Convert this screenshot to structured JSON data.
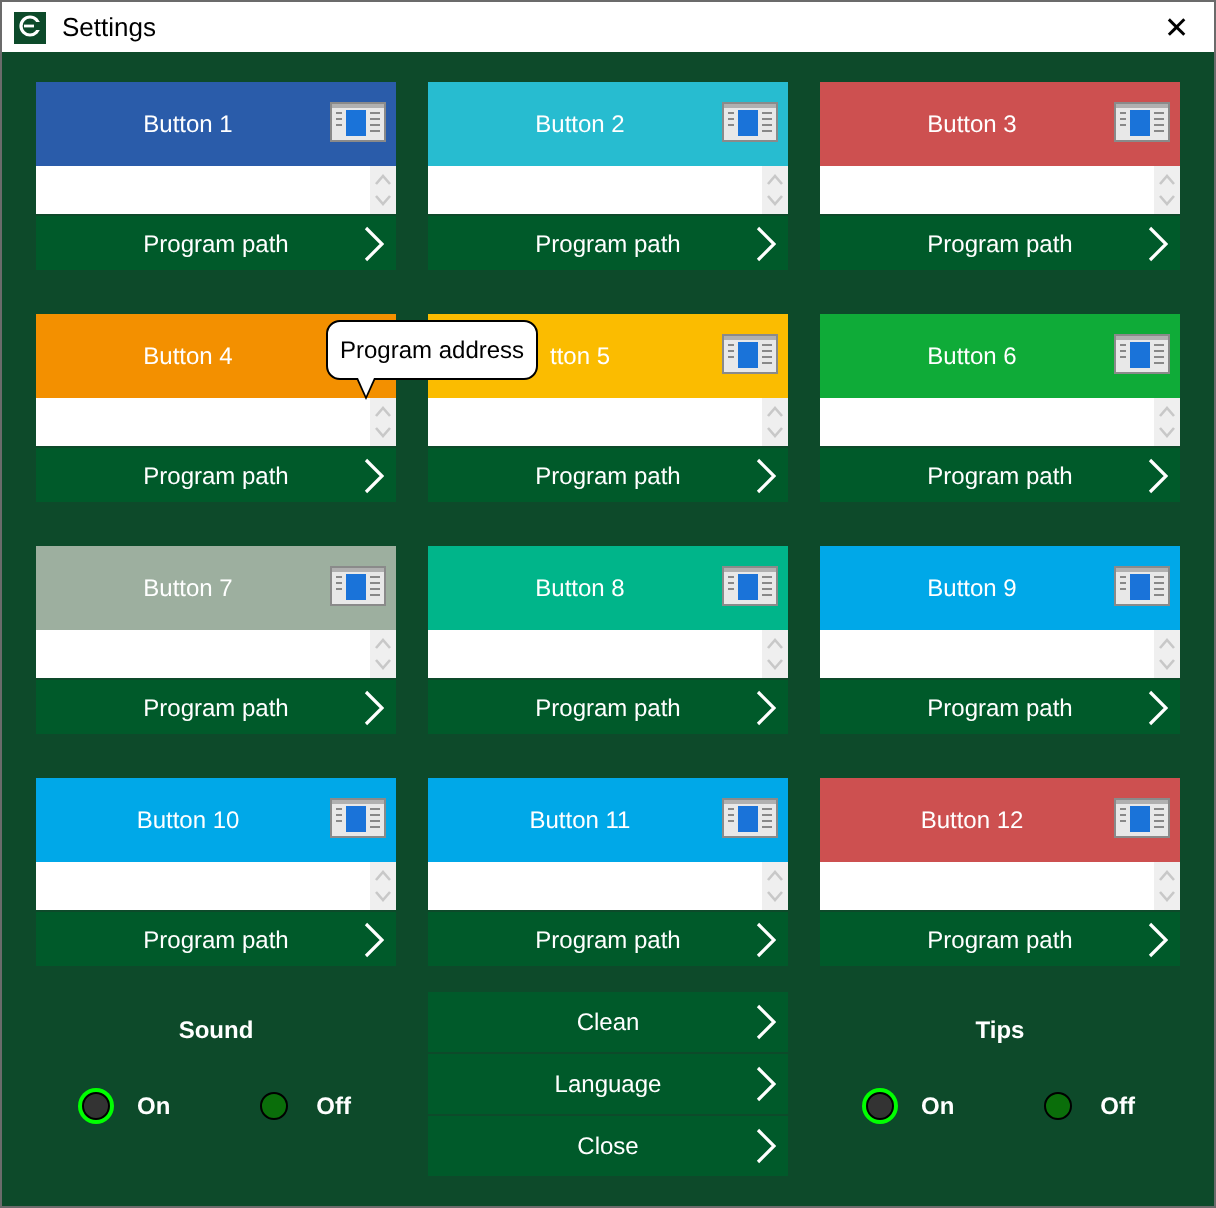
{
  "window": {
    "title": "Settings",
    "close": "✕"
  },
  "cards": [
    {
      "label": "Button 1",
      "color": "#2a5caa",
      "path": "Program path"
    },
    {
      "label": "Button 2",
      "color": "#27bcd0",
      "path": "Program path"
    },
    {
      "label": "Button 3",
      "color": "#cd5050",
      "path": "Program path"
    },
    {
      "label": "Button 4",
      "color": "#f39000",
      "path": "Program path",
      "tooltip": "Program address"
    },
    {
      "label": "tton 5",
      "color": "#fbbc00",
      "path": "Program path"
    },
    {
      "label": "Button 6",
      "color": "#0fab38",
      "path": "Program path"
    },
    {
      "label": "Button 7",
      "color": "#9daf9f",
      "path": "Program path"
    },
    {
      "label": "Button 8",
      "color": "#00b58a",
      "path": "Program path"
    },
    {
      "label": "Button 9",
      "color": "#00a8e8",
      "path": "Program path"
    },
    {
      "label": "Button 10",
      "color": "#00a8e8",
      "path": "Program path"
    },
    {
      "label": "Button 11",
      "color": "#00a8e8",
      "path": "Program path"
    },
    {
      "label": "Button 12",
      "color": "#cd5050",
      "path": "Program path"
    }
  ],
  "sound": {
    "title": "Sound",
    "options": [
      {
        "label": "On",
        "selected": true
      },
      {
        "label": "Off",
        "selected": false
      }
    ]
  },
  "actions": [
    "Clean",
    "Language",
    "Close"
  ],
  "tips": {
    "title": "Tips",
    "options": [
      {
        "label": "On",
        "selected": true
      },
      {
        "label": "Off",
        "selected": false
      }
    ]
  }
}
